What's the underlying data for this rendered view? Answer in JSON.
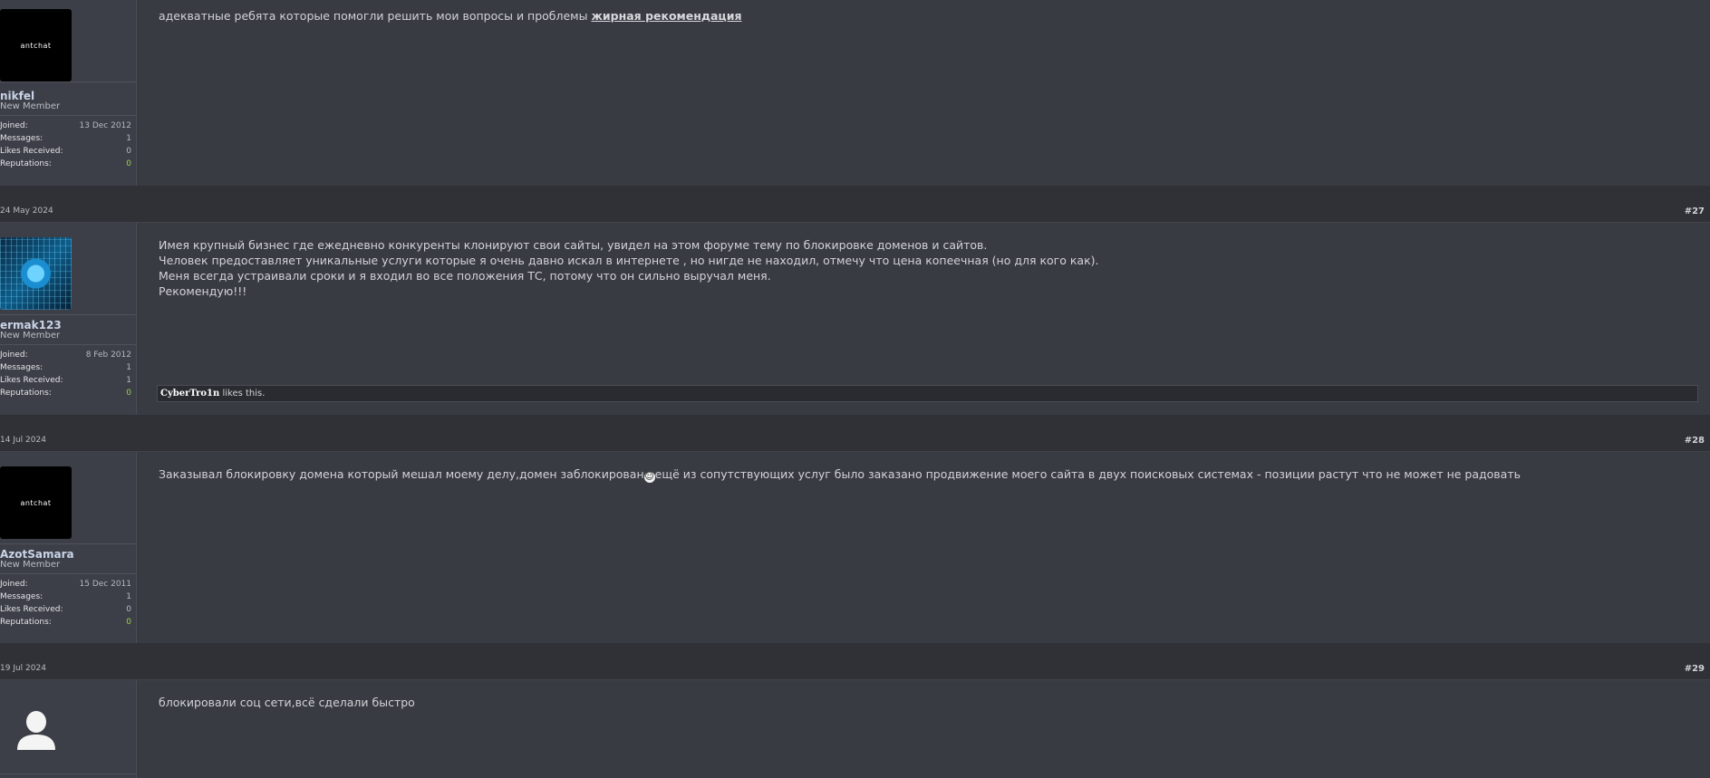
{
  "posts": [
    {
      "avatar_label": "antchat",
      "username": "nikfel",
      "title": "New Member",
      "stats": {
        "joined_label": "Joined:",
        "joined": "13 Dec 2012",
        "messages_label": "Messages:",
        "messages": "1",
        "likes_label": "Likes Received:",
        "likes": "0",
        "rep_label": "Reputations:",
        "rep": "0"
      },
      "text": "адекватные ребята которые помогли решить мои вопросы и проблемы ",
      "link": "жирная рекомендация"
    },
    {
      "date": "24 May 2024",
      "number": "#27",
      "username": "ermak123",
      "title": "New Member",
      "stats": {
        "joined_label": "Joined:",
        "joined": "8 Feb 2012",
        "messages_label": "Messages:",
        "messages": "1",
        "likes_label": "Likes Received:",
        "likes": "1",
        "rep_label": "Reputations:",
        "rep": "0"
      },
      "lines": [
        "Имея крупный бизнес где ежедневно конкуренты клонируют свои сайты, увидел на этом форуме тему по блокировке доменов и сайтов.",
        "Человек предоставляет уникальные услуги которые я очень давно искал в интернете , но нигде не находил, отмечу что цена копеечная (но для кого как).",
        "Меня всегда устраивали сроки и я входил во все положения ТС, потому что он сильно выручал меня.",
        "Рекомендую!!!"
      ],
      "liked_by": "CyberTro1n",
      "likes_suffix": " likes this."
    },
    {
      "date": "14 Jul 2024",
      "number": "#28",
      "avatar_label": "antchat",
      "username": "AzotSamara",
      "title": "New Member",
      "stats": {
        "joined_label": "Joined:",
        "joined": "15 Dec 2011",
        "messages_label": "Messages:",
        "messages": "1",
        "likes_label": "Likes Received:",
        "likes": "0",
        "rep_label": "Reputations:",
        "rep": "0"
      },
      "text_a": "Заказывал блокировку домена который мешал моему делу,домен заблокирован",
      "text_b": "ещё из сопутствующих услуг было заказано продвижение моего сайта в двух поисковых системах - позиции растут что не может не радовать"
    },
    {
      "date": "19 Jul 2024",
      "number": "#29",
      "text": "блокировали соц сети,всё сделали быстро"
    }
  ]
}
